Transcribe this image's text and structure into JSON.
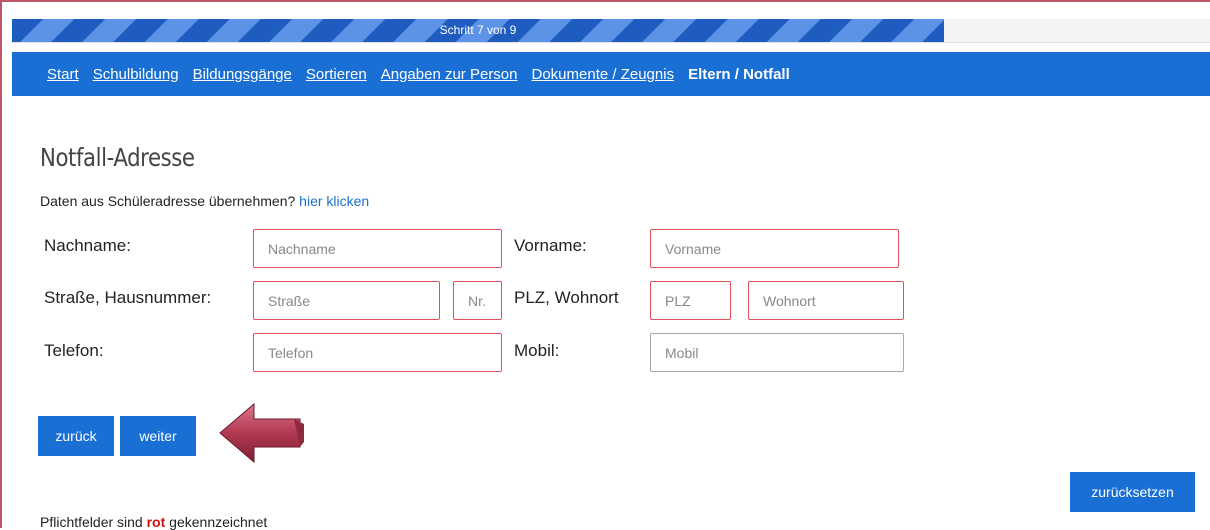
{
  "progress": {
    "label": "Schritt 7 von 9",
    "fraction": 0.7778,
    "color": "#1f5cbf"
  },
  "nav": {
    "items": [
      {
        "label": "Start"
      },
      {
        "label": "Schulbildung"
      },
      {
        "label": "Bildungsgänge"
      },
      {
        "label": "Sortieren"
      },
      {
        "label": "Angaben zur Person"
      },
      {
        "label": "Dokumente / Zeugnis"
      },
      {
        "label": "Eltern / Notfall"
      }
    ],
    "active_color": "#1a6fd4"
  },
  "page": {
    "title": "Notfall-Adresse",
    "hint_text": "Daten aus Schüleradresse übernehmen?",
    "hint_link": "hier klicken"
  },
  "form": {
    "nachname_label": "Nachname:",
    "nachname_placeholder": "Nachname",
    "vorname_label": "Vorname:",
    "vorname_placeholder": "Vorname",
    "strasse_label": "Straße, Hausnummer:",
    "strasse_placeholder": "Straße",
    "nr_placeholder": "Nr.",
    "plz_label": "PLZ, Wohnort",
    "plz_placeholder": "PLZ",
    "wohnort_placeholder": "Wohnort",
    "telefon_label": "Telefon:",
    "telefon_placeholder": "Telefon",
    "mobil_label": "Mobil:",
    "mobil_placeholder": "Mobil"
  },
  "buttons": {
    "back": "zurück",
    "next": "weiter",
    "reset": "zurücksetzen"
  },
  "footer": {
    "prefix": "Pflichtfelder sind",
    "highlight": "rot",
    "suffix": "gekennzeichnet"
  },
  "colors": {
    "required_border": "#e0505a",
    "accent": "#1a6fd4",
    "arrow": "#b23a52"
  }
}
